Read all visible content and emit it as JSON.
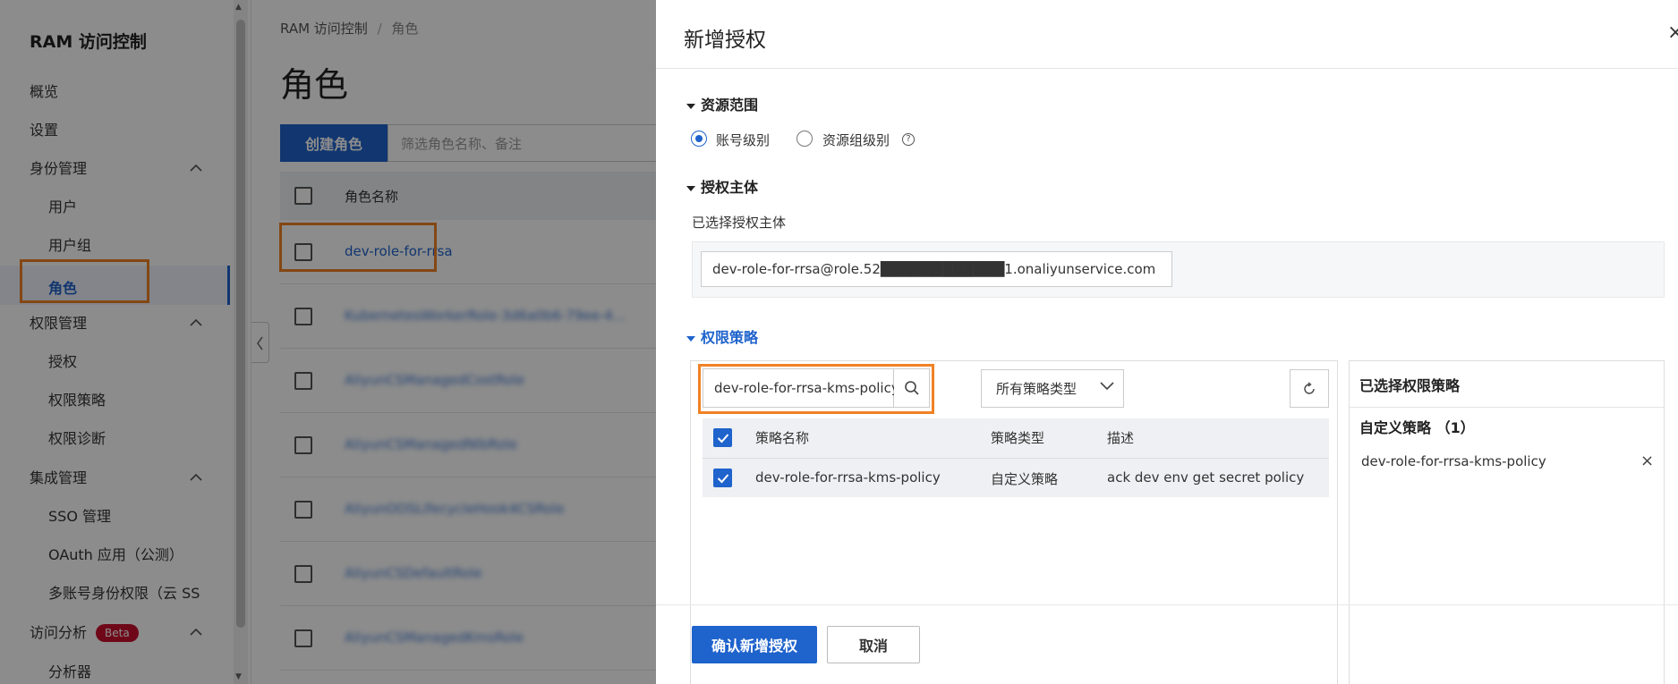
{
  "sidebar": {
    "app_title": "RAM 访问控制",
    "items": [
      {
        "label": "概览"
      },
      {
        "label": "设置"
      },
      {
        "label": "身份管理"
      },
      {
        "label": "用户"
      },
      {
        "label": "用户组"
      },
      {
        "label": "角色"
      },
      {
        "label": "权限管理"
      },
      {
        "label": "授权"
      },
      {
        "label": "权限策略"
      },
      {
        "label": "权限诊断"
      },
      {
        "label": "集成管理"
      },
      {
        "label": "SSO 管理"
      },
      {
        "label": "OAuth 应用（公测）"
      },
      {
        "label": "多账号身份权限（云 SSO"
      },
      {
        "label": "访问分析"
      },
      {
        "label": "分析器"
      }
    ],
    "beta_badge": "Beta"
  },
  "main": {
    "breadcrumb": [
      "RAM 访问控制",
      "/",
      "角色"
    ],
    "title": "角色",
    "create_button": "创建角色",
    "filter_placeholder": "筛选角色名称、备注",
    "table_header": "角色名称",
    "rows": [
      "dev-role-for-rrsa",
      "KubernetesWorkerRole-3d6a0b6-79ee-4…",
      "AliyunCSManagedCostRole",
      "AliyunCSManagedNlbRole",
      "AliyunOOSLifecycleHook4CSRole",
      "AliyunCSDefaultRole",
      "AliyunCSManagedKmsRole"
    ]
  },
  "drawer": {
    "title": "新增授权",
    "close": "×",
    "scope": {
      "title": "资源范围",
      "options": [
        "账号级别",
        "资源组级别"
      ],
      "help": "?"
    },
    "principal": {
      "title": "授权主体",
      "label": "已选择授权主体",
      "value": "dev-role-for-rrsa@role.52████████████1.onaliyunservice.com"
    },
    "policy": {
      "title": "权限策略",
      "search_value": "dev-role-for-rrsa-kms-policy",
      "type_select": "所有策略类型",
      "columns": [
        "策略名称",
        "策略类型",
        "描述"
      ],
      "rows": [
        {
          "name": "dev-role-for-rrsa-kms-policy",
          "type": "自定义策略",
          "desc": "ack dev env get secret policy"
        }
      ]
    },
    "selected": {
      "title": "已选择权限策略",
      "group": "自定义策略 （1）",
      "item": "dev-role-for-rrsa-kms-policy"
    },
    "confirm_button": "确认新增授权",
    "cancel_button": "取消"
  },
  "colors": {
    "primary": "#1f63cc",
    "highlight": "#f08125",
    "beta": "#c8102e"
  }
}
